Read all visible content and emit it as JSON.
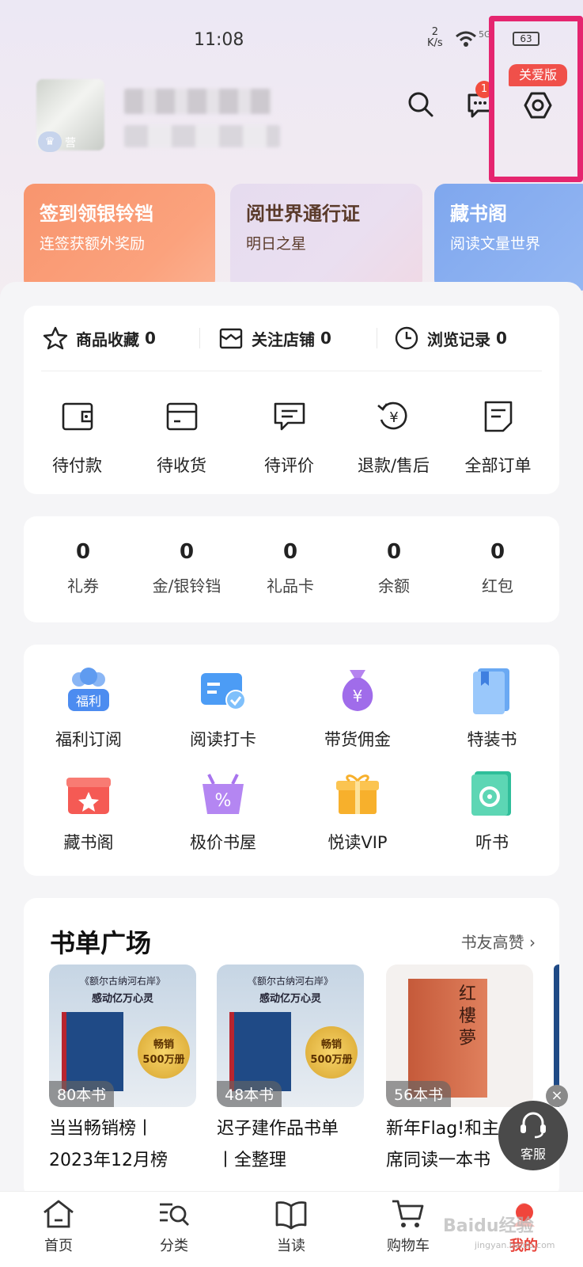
{
  "status_bar": {
    "time": "11:08",
    "net_speed": "2",
    "net_unit": "K/s",
    "signal": "5G",
    "battery": "63"
  },
  "header": {
    "vip_tag": "营",
    "message_badge": "1",
    "care_mode_label": "关爱版"
  },
  "promos": [
    {
      "title": "签到领银铃铛",
      "subtitle": "连签获额外奖励"
    },
    {
      "title": "阅世界通行证",
      "subtitle": "明日之星"
    },
    {
      "title": "藏书阁",
      "subtitle": "阅读文量世界"
    }
  ],
  "favorites": [
    {
      "label": "商品收藏",
      "count": "0",
      "icon": "star-icon"
    },
    {
      "label": "关注店铺",
      "count": "0",
      "icon": "store-icon"
    },
    {
      "label": "浏览记录",
      "count": "0",
      "icon": "clock-icon"
    }
  ],
  "orders": [
    {
      "label": "待付款",
      "icon": "wallet-icon"
    },
    {
      "label": "待收货",
      "icon": "card-icon"
    },
    {
      "label": "待评价",
      "icon": "comment-icon"
    },
    {
      "label": "退款/售后",
      "icon": "refund-icon"
    },
    {
      "label": "全部订单",
      "icon": "order-list-icon"
    }
  ],
  "assets": [
    {
      "value": "0",
      "label": "礼券"
    },
    {
      "value": "0",
      "label": "金/银铃铛"
    },
    {
      "value": "0",
      "label": "礼品卡"
    },
    {
      "value": "0",
      "label": "余额"
    },
    {
      "value": "0",
      "label": "红包"
    }
  ],
  "services": [
    {
      "label": "福利订阅",
      "icon": "welfare-icon",
      "icon_text": "福利"
    },
    {
      "label": "阅读打卡",
      "icon": "reading-checkin-icon"
    },
    {
      "label": "带货佣金",
      "icon": "money-bag-icon",
      "icon_text": "¥"
    },
    {
      "label": "特装书",
      "icon": "special-book-icon"
    },
    {
      "label": "藏书阁",
      "icon": "gift-box-icon"
    },
    {
      "label": "极价书屋",
      "icon": "discount-basket-icon",
      "icon_text": "%"
    },
    {
      "label": "悦读VIP",
      "icon": "vip-gift-icon"
    },
    {
      "label": "听书",
      "icon": "audiobook-icon"
    }
  ],
  "booklist": {
    "title": "书单广场",
    "more_label": "书友高赞",
    "items": [
      {
        "count": "80本书",
        "title1": "当当畅销榜丨",
        "title2": "2023年12月榜",
        "cover_line1": "《额尔古纳河右岸》",
        "cover_line2": "感动亿万心灵",
        "seal1": "畅销",
        "seal2": "500万册"
      },
      {
        "count": "48本书",
        "title1": "迟子建作品书单",
        "title2": "丨全整理",
        "cover_line1": "《额尔古纳河右岸》",
        "cover_line2": "感动亿万心灵",
        "seal1": "畅销",
        "seal2": "500万册"
      },
      {
        "count": "56本书",
        "title1": "新年Flag!和主",
        "title2": "席同读一本书",
        "cover_text": "红樓夢"
      }
    ]
  },
  "customer_service": {
    "label": "客服",
    "close": "×"
  },
  "tabbar": [
    {
      "label": "首页",
      "icon": "home-icon"
    },
    {
      "label": "分类",
      "icon": "category-search-icon"
    },
    {
      "label": "当读",
      "icon": "open-book-icon"
    },
    {
      "label": "购物车",
      "icon": "cart-icon"
    },
    {
      "label": "我的",
      "icon": "profile-icon"
    }
  ],
  "watermark": {
    "brand": "Baidu经验",
    "url": "jingyan.baidu.com"
  },
  "colors": {
    "accent": "#e8453c",
    "highlight": "#e5256f",
    "care_badge": "#f0504a"
  }
}
